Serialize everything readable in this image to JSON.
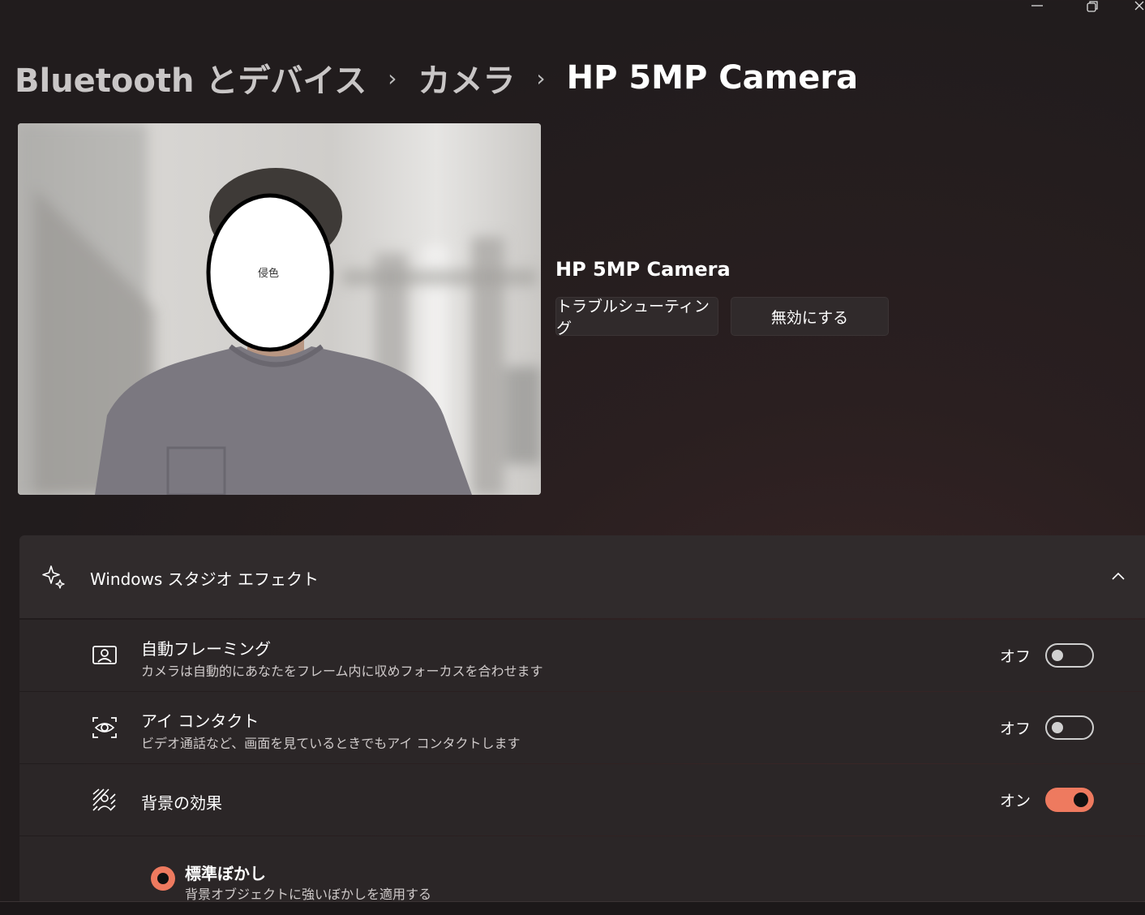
{
  "breadcrumb": {
    "items": [
      "Bluetooth とデバイス",
      "カメラ",
      "HP 5MP Camera"
    ],
    "separator": "›"
  },
  "preview": {
    "face_label": "侵色"
  },
  "device": {
    "name": "HP 5MP Camera",
    "troubleshoot_label": "トラブルシューティング",
    "disable_label": "無効にする"
  },
  "studio_effects": {
    "title": "Windows スタジオ エフェクト",
    "settings": [
      {
        "title": "自動フレーミング",
        "subtitle": "カメラは自動的にあなたをフレーム内に収めフォーカスを合わせます",
        "state": "オフ",
        "on": false,
        "icon": "framing-icon"
      },
      {
        "title": "アイ コンタクト",
        "subtitle": "ビデオ通話など、画面を見ているときでもアイ コンタクトします",
        "state": "オフ",
        "on": false,
        "icon": "eye-contact-icon"
      },
      {
        "title": "背景の効果",
        "subtitle": "",
        "state": "オン",
        "on": true,
        "icon": "background-effects-icon"
      }
    ],
    "blur_option": {
      "title": "標準ぼかし",
      "subtitle": "背景オブジェクトに強いぼかしを適用する",
      "selected": true
    }
  },
  "colors": {
    "accent": "#ee7a5f",
    "background": "#211c1d",
    "card": "#2b2627"
  }
}
